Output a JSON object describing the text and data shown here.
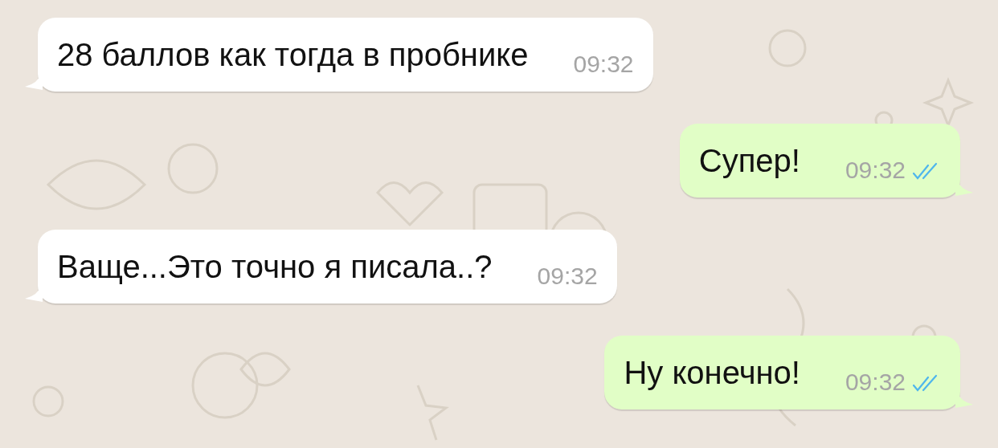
{
  "messages": [
    {
      "kind": "incoming",
      "text": "28 баллов как тогда в пробнике",
      "time": "09:32"
    },
    {
      "kind": "outgoing",
      "text": "Супер!",
      "time": "09:32",
      "read": true
    },
    {
      "kind": "incoming",
      "text": "Ваще...Это точно я писала..?",
      "time": "09:32"
    },
    {
      "kind": "outgoing",
      "text": "Ну конечно!",
      "time": "09:32",
      "read": true
    }
  ]
}
